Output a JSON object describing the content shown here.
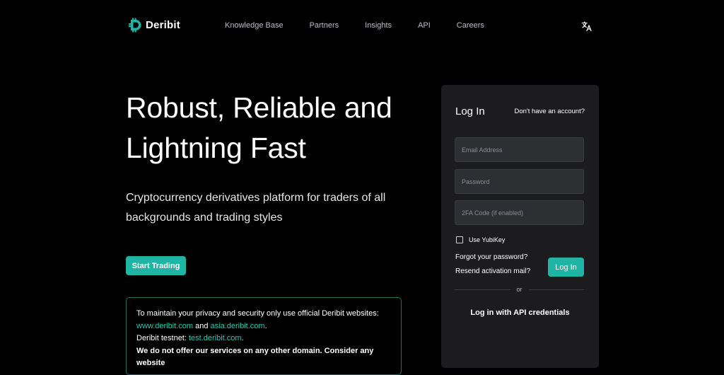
{
  "header": {
    "brand": "Deribit",
    "nav": [
      "Knowledge Base",
      "Partners",
      "Insights",
      "API",
      "Careers"
    ]
  },
  "hero": {
    "title": "Robust, Reliable and Lightning Fast",
    "subtitle": "Cryptocurrency derivatives platform for traders of all backgrounds and trading styles",
    "cta_label": "Start Trading"
  },
  "notice": {
    "intro": "To maintain your privacy and security only use official Deribit websites:",
    "link1": "www.deribit.com",
    "and": " and ",
    "link2": "asia.deribit.com",
    "period": ".",
    "testnet_label": "Deribit testnet: ",
    "testnet_link": "test.deribit.com",
    "warning": "We do not offer our services on any other domain. Consider any website"
  },
  "login": {
    "title": "Log In",
    "no_account": "Don't have an account?",
    "email_placeholder": "Email Address",
    "password_placeholder": "Password",
    "tfa_placeholder": "2FA Code (if enabled)",
    "yubikey_label": "Use YubiKey",
    "forgot": "Forgot your password?",
    "resend": "Resend activation mail?",
    "button": "Log In",
    "or": "or",
    "api_login": "Log in with API credentials"
  },
  "colors": {
    "accent": "#1fb5a4",
    "link": "#2ec7b2",
    "background": "#000000",
    "panel": "#1c1c1f"
  },
  "icons": {
    "logo": "deribit-logo-icon",
    "language": "translate-icon",
    "checkbox": "checkbox-icon"
  }
}
